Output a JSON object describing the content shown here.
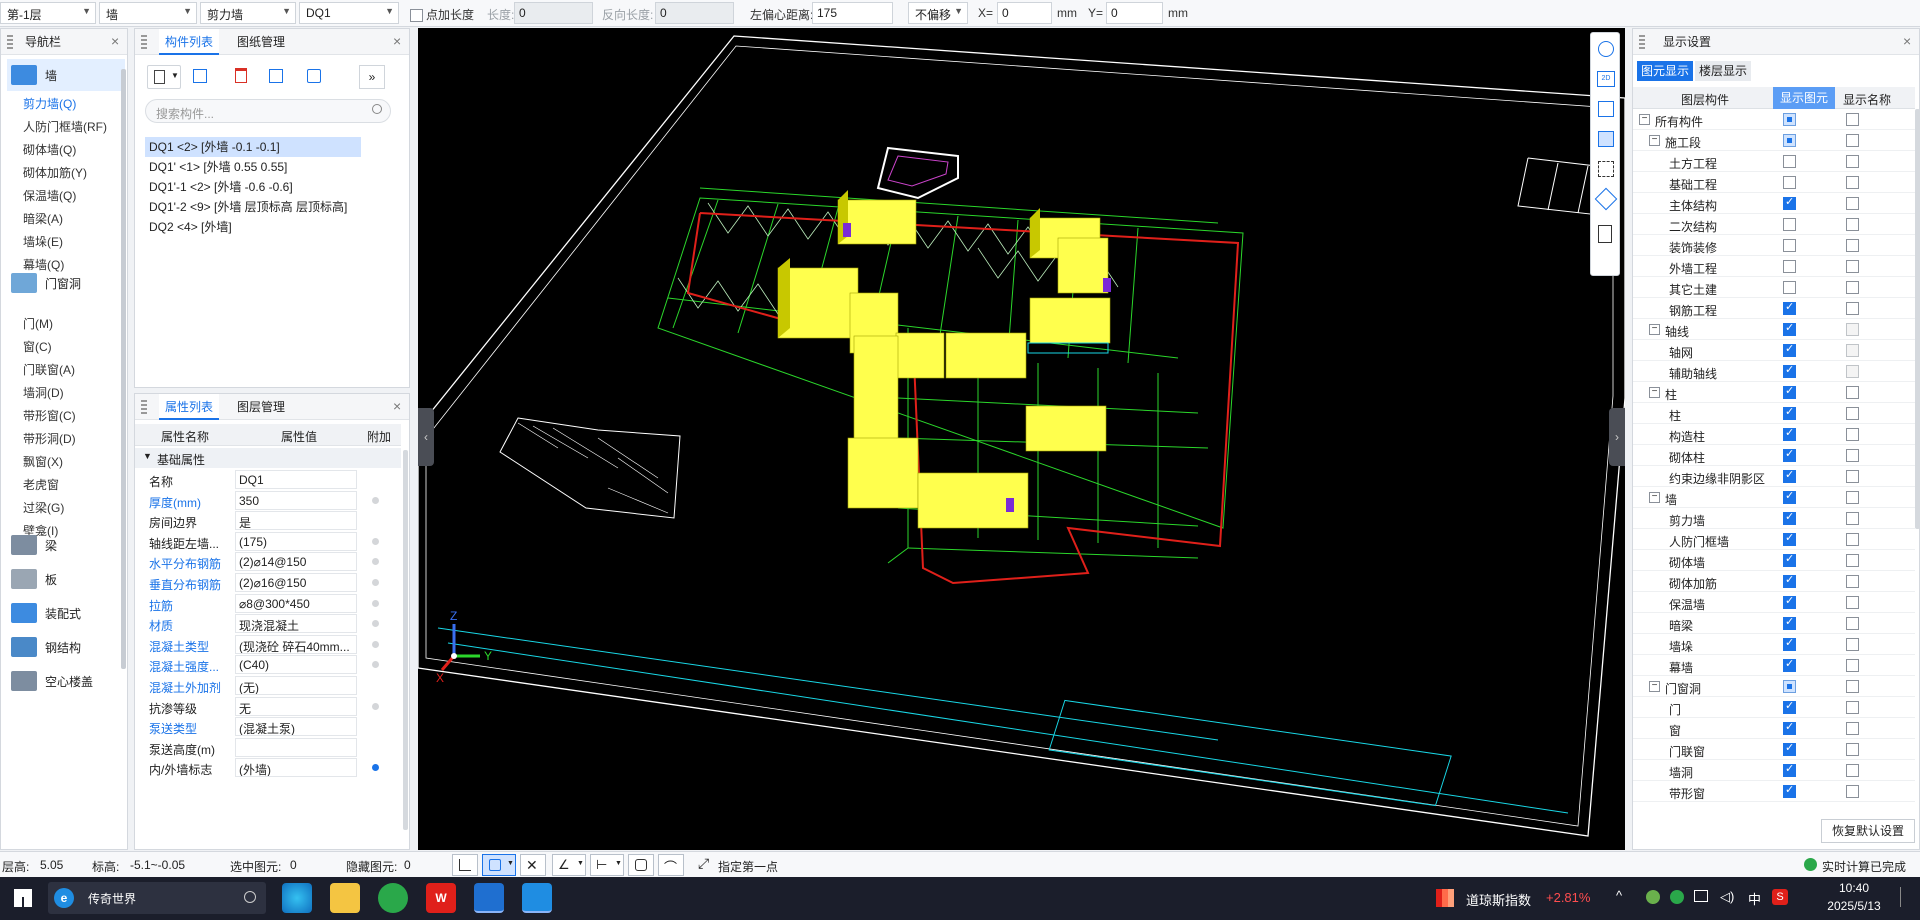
{
  "toolbar": {
    "floor": "第-1层",
    "category": "墙",
    "type": "剪力墙",
    "component": "DQ1",
    "add_length_label": "点加长度",
    "length_label": "长度:",
    "length_value": "0",
    "reverse_length_label": "反向长度:",
    "reverse_length_value": "0",
    "left_offset_label": "左偏心距离:",
    "left_offset_value": "175",
    "offset_mode": "不偏移",
    "x_label": "X=",
    "x_value": "0",
    "y_label": "Y=",
    "y_value": "0",
    "unit": "mm"
  },
  "nav": {
    "title": "导航栏",
    "categories": [
      {
        "label": "墙",
        "icon": "wall-icon"
      },
      {
        "label": "门窗洞",
        "icon": "door-window-icon"
      },
      {
        "label": "梁",
        "icon": "beam-icon"
      },
      {
        "label": "板",
        "icon": "slab-icon"
      },
      {
        "label": "装配式",
        "icon": "prefab-icon"
      },
      {
        "label": "钢结构",
        "icon": "steel-icon"
      },
      {
        "label": "空心楼盖",
        "icon": "hollow-floor-icon"
      }
    ],
    "wall_items": [
      "剪力墙(Q)",
      "人防门框墙(RF)",
      "砌体墙(Q)",
      "砌体加筋(Y)",
      "保温墙(Q)",
      "暗梁(A)",
      "墙垛(E)",
      "幕墙(Q)"
    ],
    "door_items": [
      "门(M)",
      "窗(C)",
      "门联窗(A)",
      "墙洞(D)",
      "带形窗(C)",
      "带形洞(D)",
      "飘窗(X)",
      "老虎窗",
      "过梁(G)",
      "壁龛(I)"
    ]
  },
  "component_panel": {
    "tabs": [
      "构件列表",
      "图纸管理"
    ],
    "search_placeholder": "搜索构件...",
    "items": [
      "DQ1 <2> [外墙 -0.1 -0.1]",
      "DQ1' <1> [外墙 0.55 0.55]",
      "DQ1'-1 <2> [外墙 -0.6 -0.6]",
      "DQ1'-2 <9> [外墙 层顶标高 层顶标高]",
      "DQ2 <4> [外墙]"
    ]
  },
  "property_panel": {
    "tabs": [
      "属性列表",
      "图层管理"
    ],
    "headers": [
      "属性名称",
      "属性值",
      "附加"
    ],
    "group": "基础属性",
    "rows": [
      {
        "name": "名称",
        "value": "DQ1",
        "blue": false,
        "dot": ""
      },
      {
        "name": "厚度(mm)",
        "value": "350",
        "blue": true,
        "dot": "grey"
      },
      {
        "name": "房间边界",
        "value": "是",
        "blue": false,
        "dot": ""
      },
      {
        "name": "轴线距左墙...",
        "value": "(175)",
        "blue": false,
        "dot": "grey"
      },
      {
        "name": "水平分布钢筋",
        "value": "(2)⌀14@150",
        "blue": true,
        "dot": "grey"
      },
      {
        "name": "垂直分布钢筋",
        "value": "(2)⌀16@150",
        "blue": true,
        "dot": "grey"
      },
      {
        "name": "拉筋",
        "value": "⌀8@300*450",
        "blue": true,
        "dot": "grey"
      },
      {
        "name": "材质",
        "value": "现浇混凝土",
        "blue": true,
        "dot": "grey"
      },
      {
        "name": "混凝土类型",
        "value": "(现浇砼 碎石40mm...",
        "blue": true,
        "dot": "grey"
      },
      {
        "name": "混凝土强度...",
        "value": "(C40)",
        "blue": true,
        "dot": "grey"
      },
      {
        "name": "混凝土外加剂",
        "value": "(无)",
        "blue": true,
        "dot": ""
      },
      {
        "name": "抗渗等级",
        "value": "无",
        "blue": false,
        "dot": "grey"
      },
      {
        "name": "泵送类型",
        "value": "(混凝土泵)",
        "blue": true,
        "dot": ""
      },
      {
        "name": "泵送高度(m)",
        "value": "",
        "blue": false,
        "dot": ""
      },
      {
        "name": "内/外墙标志",
        "value": "(外墙)",
        "blue": false,
        "dot": "blue"
      }
    ]
  },
  "display_panel": {
    "title": "显示设置",
    "tabs": [
      "图元显示",
      "楼层显示"
    ],
    "headers": [
      "图层构件",
      "显示图元",
      "显示名称"
    ],
    "reset_button": "恢复默认设置",
    "rows": [
      {
        "label": "所有构件",
        "level": 0,
        "expand": true,
        "c1": "part",
        "c2": "off"
      },
      {
        "label": "施工段",
        "level": 1,
        "expand": true,
        "c1": "part",
        "c2": "off"
      },
      {
        "label": "土方工程",
        "level": 2,
        "expand": false,
        "c1": "off",
        "c2": "off"
      },
      {
        "label": "基础工程",
        "level": 2,
        "expand": false,
        "c1": "off",
        "c2": "off"
      },
      {
        "label": "主体结构",
        "level": 2,
        "expand": false,
        "c1": "on",
        "c2": "off"
      },
      {
        "label": "二次结构",
        "level": 2,
        "expand": false,
        "c1": "off",
        "c2": "off"
      },
      {
        "label": "装饰装修",
        "level": 2,
        "expand": false,
        "c1": "off",
        "c2": "off"
      },
      {
        "label": "外墙工程",
        "level": 2,
        "expand": false,
        "c1": "off",
        "c2": "off"
      },
      {
        "label": "其它土建",
        "level": 2,
        "expand": false,
        "c1": "off",
        "c2": "off"
      },
      {
        "label": "钢筋工程",
        "level": 2,
        "expand": false,
        "c1": "on",
        "c2": "off"
      },
      {
        "label": "轴线",
        "level": 1,
        "expand": true,
        "c1": "on",
        "c2": "dis"
      },
      {
        "label": "轴网",
        "level": 2,
        "expand": false,
        "c1": "on",
        "c2": "dis"
      },
      {
        "label": "辅助轴线",
        "level": 2,
        "expand": false,
        "c1": "on",
        "c2": "dis"
      },
      {
        "label": "柱",
        "level": 1,
        "expand": true,
        "c1": "on",
        "c2": "off"
      },
      {
        "label": "柱",
        "level": 2,
        "expand": false,
        "c1": "on",
        "c2": "off"
      },
      {
        "label": "构造柱",
        "level": 2,
        "expand": false,
        "c1": "on",
        "c2": "off"
      },
      {
        "label": "砌体柱",
        "level": 2,
        "expand": false,
        "c1": "on",
        "c2": "off"
      },
      {
        "label": "约束边缘非阴影区",
        "level": 2,
        "expand": false,
        "c1": "on",
        "c2": "off"
      },
      {
        "label": "墙",
        "level": 1,
        "expand": true,
        "c1": "on",
        "c2": "off"
      },
      {
        "label": "剪力墙",
        "level": 2,
        "expand": false,
        "c1": "on",
        "c2": "off"
      },
      {
        "label": "人防门框墙",
        "level": 2,
        "expand": false,
        "c1": "on",
        "c2": "off"
      },
      {
        "label": "砌体墙",
        "level": 2,
        "expand": false,
        "c1": "on",
        "c2": "off"
      },
      {
        "label": "砌体加筋",
        "level": 2,
        "expand": false,
        "c1": "on",
        "c2": "off"
      },
      {
        "label": "保温墙",
        "level": 2,
        "expand": false,
        "c1": "on",
        "c2": "off"
      },
      {
        "label": "暗梁",
        "level": 2,
        "expand": false,
        "c1": "on",
        "c2": "off"
      },
      {
        "label": "墙垛",
        "level": 2,
        "expand": false,
        "c1": "on",
        "c2": "off"
      },
      {
        "label": "幕墙",
        "level": 2,
        "expand": false,
        "c1": "on",
        "c2": "off"
      },
      {
        "label": "门窗洞",
        "level": 1,
        "expand": true,
        "c1": "part",
        "c2": "off"
      },
      {
        "label": "门",
        "level": 2,
        "expand": false,
        "c1": "on",
        "c2": "off"
      },
      {
        "label": "窗",
        "level": 2,
        "expand": false,
        "c1": "on",
        "c2": "off"
      },
      {
        "label": "门联窗",
        "level": 2,
        "expand": false,
        "c1": "on",
        "c2": "off"
      },
      {
        "label": "墙洞",
        "level": 2,
        "expand": false,
        "c1": "on",
        "c2": "off"
      },
      {
        "label": "带形窗",
        "level": 2,
        "expand": false,
        "c1": "on",
        "c2": "off"
      }
    ]
  },
  "statusbar": {
    "floor_height_label": "层高:",
    "floor_height": "5.05",
    "elevation_label": "标高:",
    "elevation": "-5.1~-0.05",
    "selected_label": "选中图元:",
    "selected": "0",
    "hidden_label": "隐藏图元:",
    "hidden": "0",
    "hint": "指定第一点",
    "realtime": "实时计算已完成"
  },
  "viewport": {
    "axis_x": "X",
    "axis_y": "Y",
    "axis_z": "Z"
  },
  "taskbar": {
    "search_text": "传奇世界",
    "stock_name": "道琼斯指数",
    "stock_change": "+2.81%",
    "ime": "中",
    "time": "10:40",
    "date": "2025/5/13"
  },
  "colors": {
    "accent": "#1a73e8",
    "viewport_bg": "#000000",
    "wall_yellow": "#ffff4d",
    "axis_green": "#2bd62b",
    "boundary_red": "#e0201a",
    "frame_cyan": "#19d7e6",
    "stock_up": "#ff4d4f"
  }
}
